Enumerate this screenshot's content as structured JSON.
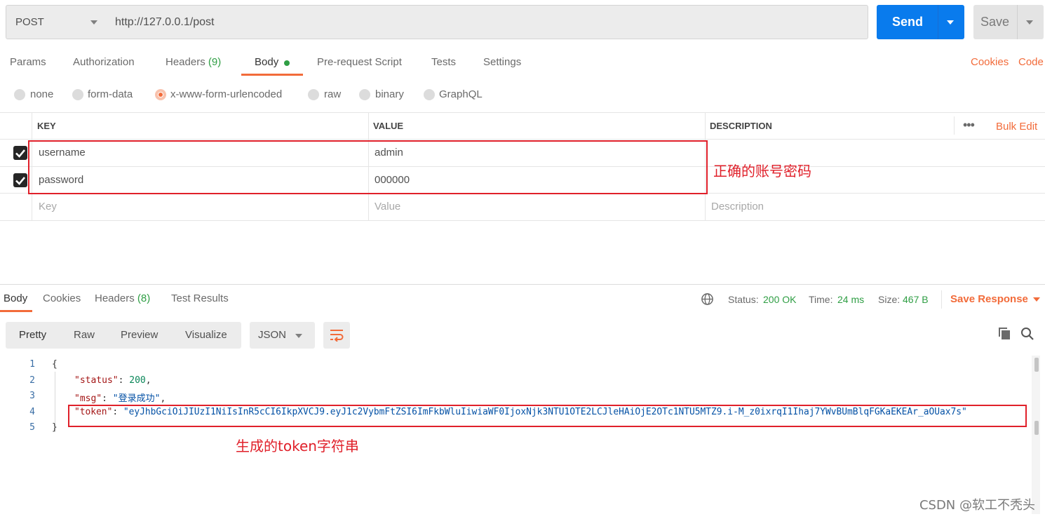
{
  "request": {
    "method": "POST",
    "url": "http://127.0.0.1/post",
    "send_label": "Send",
    "save_label": "Save"
  },
  "tabs": {
    "params": "Params",
    "authorization": "Authorization",
    "headers": "Headers",
    "headers_count": "(9)",
    "body": "Body",
    "prerequest": "Pre-request Script",
    "tests": "Tests",
    "settings": "Settings",
    "cookies": "Cookies",
    "code": "Code"
  },
  "body_types": {
    "none": "none",
    "form_data": "form-data",
    "urlencoded": "x-www-form-urlencoded",
    "raw": "raw",
    "binary": "binary",
    "graphql": "GraphQL",
    "selected": "x-www-form-urlencoded"
  },
  "table": {
    "headers": {
      "key": "KEY",
      "value": "VALUE",
      "description": "DESCRIPTION"
    },
    "bulk_edit": "Bulk Edit",
    "rows": [
      {
        "key": "username",
        "value": "admin"
      },
      {
        "key": "password",
        "value": "000000"
      }
    ],
    "placeholders": {
      "key": "Key",
      "value": "Value",
      "description": "Description"
    }
  },
  "annotations": {
    "credentials": "正确的账号密码",
    "token": "生成的token字符串"
  },
  "response": {
    "tabs": {
      "body": "Body",
      "cookies": "Cookies",
      "headers": "Headers",
      "headers_count": "(8)",
      "test_results": "Test Results"
    },
    "status_label": "Status:",
    "status_value": "200 OK",
    "time_label": "Time:",
    "time_value": "24 ms",
    "size_label": "Size:",
    "size_value": "467 B",
    "save_response": "Save Response",
    "views": {
      "pretty": "Pretty",
      "raw": "Raw",
      "preview": "Preview",
      "visualize": "Visualize"
    },
    "format": "JSON",
    "line_numbers": [
      "1",
      "2",
      "3",
      "4",
      "5"
    ],
    "json": {
      "open": "{",
      "status_key": "\"status\"",
      "status_val": "200",
      "msg_key": "\"msg\"",
      "msg_val": "\"登录成功\"",
      "token_key": "\"token\"",
      "token_val": "\"eyJhbGciOiJIUzI1NiIsInR5cCI6IkpXVCJ9.eyJ1c2VybmFtZSI6ImFkbWluIiwiaWF0IjoxNjk3NTU1OTE2LCJleHAiOjE2OTc1NTU5MTZ9.i-M_z0ixrqI1Ihaj7YWvBUmBlqFGKaEKEAr_aOUax7s\"",
      "close": "}"
    }
  },
  "watermark": "CSDN @软工不秃头",
  "colors": {
    "accent": "#f26b3a",
    "send": "#097bed",
    "status_ok": "#2f9e44",
    "annotation": "#e0202a"
  }
}
